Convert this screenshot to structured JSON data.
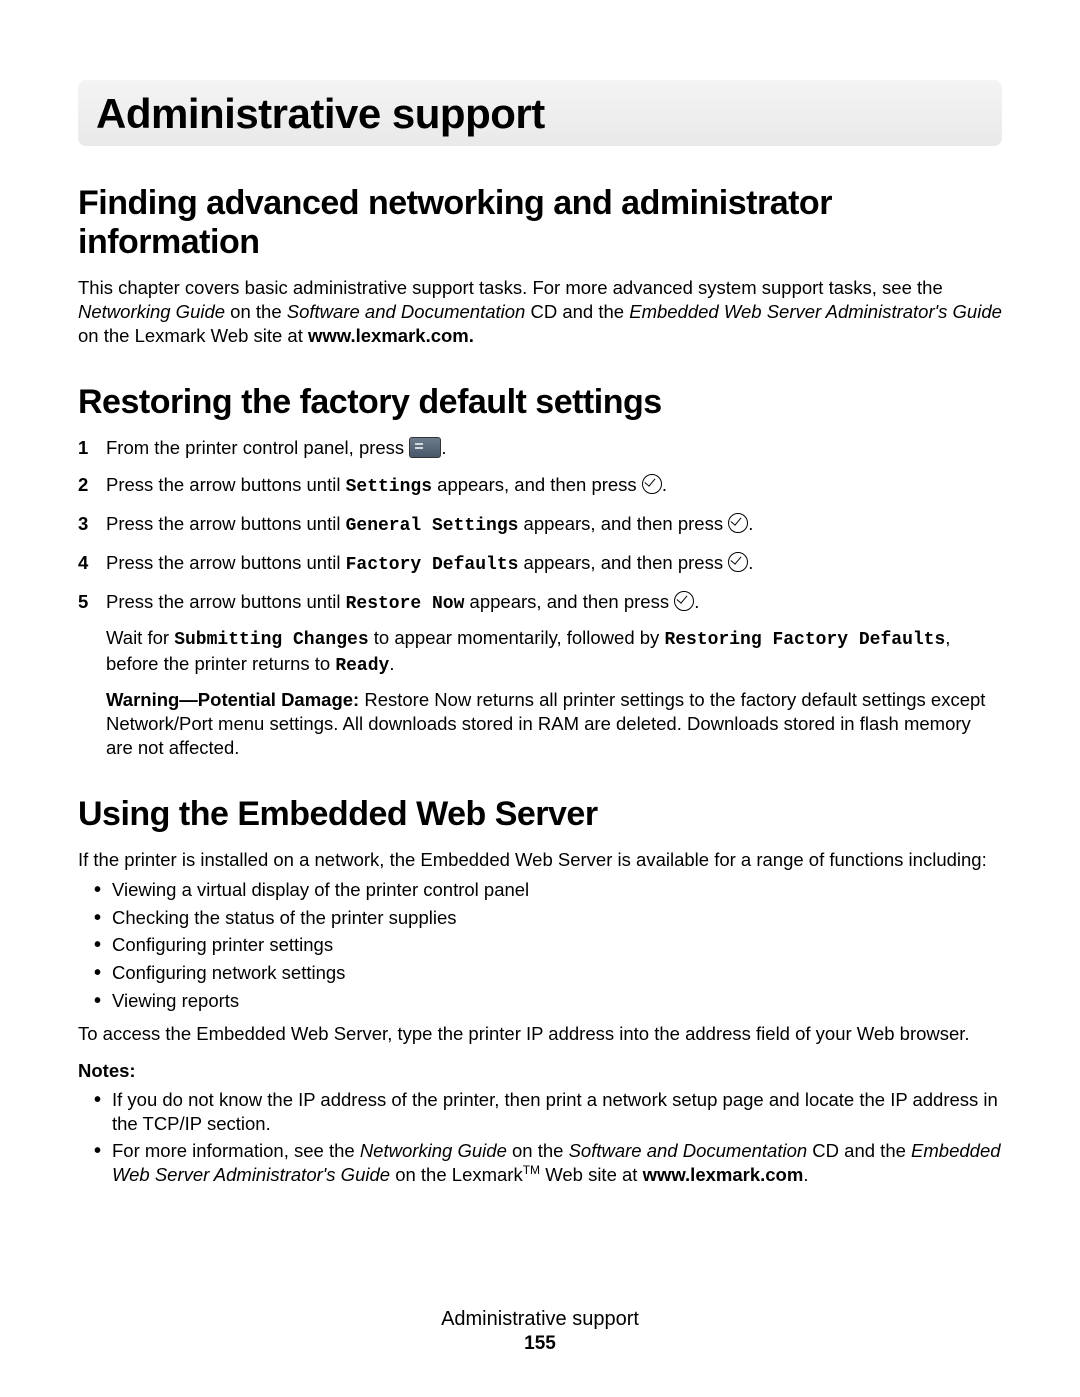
{
  "chapter_title": "Administrative support",
  "section1": {
    "heading": "Finding advanced networking and administrator information",
    "body_pre": "This chapter covers basic administrative support tasks. For more advanced system support tasks, see the ",
    "net_guide_i": "Networking Guide",
    "body_mid1": " on the ",
    "sw_cd_i": "Software and Documentation",
    "body_mid2": " CD and the ",
    "ews_guide_i": "Embedded Web Server Administrator's Guide",
    "body_mid3": " on the Lexmark Web site at ",
    "site_b": "www.lexmark.com.",
    "body_end": ""
  },
  "section2": {
    "heading": "Restoring the factory default settings",
    "steps": {
      "s1": "From the printer control panel, press ",
      "s1_end": ".",
      "s2a": "Press the arrow buttons until ",
      "s2m": "Settings",
      "s2b": " appears, and then press ",
      "s2_end": ".",
      "s3a": "Press the arrow buttons until ",
      "s3m": "General Settings",
      "s3b": " appears, and then press ",
      "s3_end": ".",
      "s4a": "Press the arrow buttons until ",
      "s4m": "Factory Defaults",
      "s4b": " appears, and then press ",
      "s4_end": ".",
      "s5a": "Press the arrow buttons until ",
      "s5m": "Restore Now",
      "s5b": " appears, and then press ",
      "s5_end": ".",
      "sub1_a": "Wait for ",
      "sub1_m1": "Submitting Changes",
      "sub1_b": " to appear momentarily, followed by ",
      "sub1_m2": "Restoring Factory Defaults",
      "sub1_c": ", before the printer returns to ",
      "sub1_m3": "Ready",
      "sub1_end": ".",
      "warn_label": "Warning—Potential Damage: ",
      "warn_body": "Restore Now returns all printer settings to the factory default settings except Network/Port menu settings. All downloads stored in RAM are deleted. Downloads stored in flash memory are not affected."
    }
  },
  "section3": {
    "heading": "Using the Embedded Web Server",
    "intro": "If the printer is installed on a network, the Embedded Web Server is available for a range of functions including:",
    "bullets": [
      "Viewing a virtual display of the printer control panel",
      "Checking the status of the printer supplies",
      "Configuring printer settings",
      "Configuring network settings",
      "Viewing reports"
    ],
    "access": "To access the Embedded Web Server, type the printer IP address into the address field of your Web browser.",
    "notes_label": "Notes:",
    "note1": "If you do not know the IP address of the printer, then print a network setup page and locate the IP address in the TCP/IP section.",
    "note2_a": "For more information, see the ",
    "note2_i1": "Networking Guide",
    "note2_b": " on the ",
    "note2_i2": "Software and Documentation",
    "note2_c": " CD and the ",
    "note2_i3": "Embedded Web Server Administrator's Guide",
    "note2_d": " on the Lexmark",
    "note2_tm": "TM",
    "note2_e": " Web site at ",
    "note2_bold": "www.lexmark.com",
    "note2_end": "."
  },
  "footer": {
    "section": "Administrative support",
    "page": "155"
  }
}
